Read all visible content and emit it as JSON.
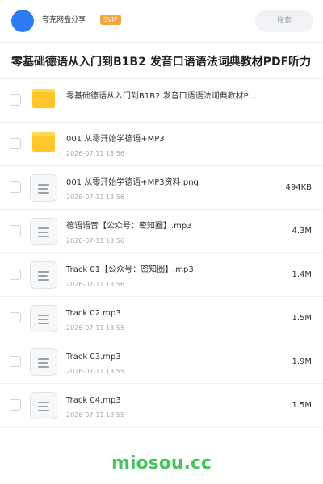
{
  "header": {
    "app_name": "夸克网盘分享",
    "badge": "SVIP",
    "search_label": "搜索"
  },
  "title": "零基础德语从入门到B1B2 发音口语语法词典教材PDF听力",
  "files": [
    {
      "type": "folder",
      "name": "零基础德语从入门到B1B2 发音口语语法词典教材P…",
      "date": "",
      "size": ""
    },
    {
      "type": "folder",
      "name": "001 从零开始学德语+MP3",
      "date": "2026-07-11 13:56",
      "size": ""
    },
    {
      "type": "file",
      "name": "001 从零开始学德语+MP3资料.png",
      "date": "2026-07-11 13:56",
      "size": "494KB"
    },
    {
      "type": "file",
      "name": "德语语音【公众号：密知圈】.mp3",
      "date": "2026-07-11 13:56",
      "size": "4.3M"
    },
    {
      "type": "file",
      "name": "Track 01【公众号：密知圈】.mp3",
      "date": "2026-07-11 13:56",
      "size": "1.4M"
    },
    {
      "type": "file",
      "name": "Track 02.mp3",
      "date": "2026-07-11 13:55",
      "size": "1.5M"
    },
    {
      "type": "file",
      "name": "Track 03.mp3",
      "date": "2026-07-11 13:55",
      "size": "1.9M"
    },
    {
      "type": "file",
      "name": "Track 04.mp3",
      "date": "2026-07-11 13:55",
      "size": "1.5M"
    }
  ],
  "footer": {
    "brand": "miosou.cc"
  },
  "colors": {
    "accent": "#2f7bf6",
    "badge": "#f7a23b",
    "folder": "#ffc72c",
    "brand": "#49c35b"
  }
}
